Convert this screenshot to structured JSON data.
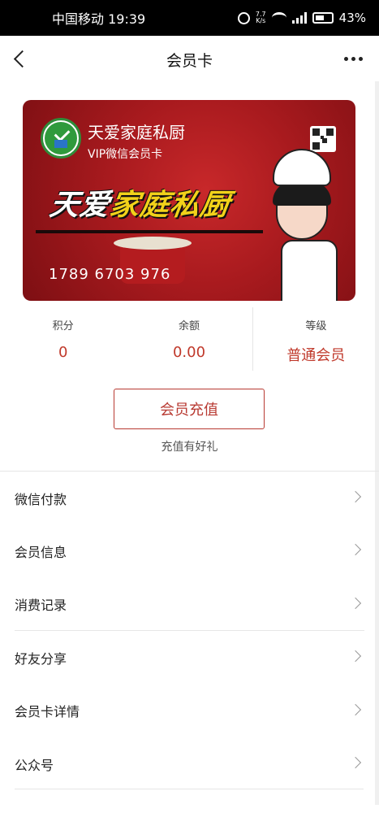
{
  "status_bar": {
    "carrier_time": "中国移动 19:39",
    "net_speed_top": "7.7",
    "net_speed_bottom": "K/s",
    "battery": "43%"
  },
  "nav": {
    "title": "会员卡"
  },
  "card": {
    "shop_name": "天爱家庭私厨",
    "card_type": "VIP微信会员卡",
    "banner_part1": "天爱",
    "banner_part2": "家庭私厨",
    "number": "1789 6703 976",
    "colors": {
      "card": "#a81a1e",
      "accent": "#f2d21a"
    }
  },
  "stats": [
    {
      "label": "积分",
      "value": "0"
    },
    {
      "label": "余额",
      "value": "0.00"
    },
    {
      "label": "等级",
      "value": "普通会员"
    }
  ],
  "recharge": {
    "button_label": "会员充值",
    "tip": "充值有好礼"
  },
  "menu": [
    {
      "label": "微信付款"
    },
    {
      "label": "会员信息"
    },
    {
      "label": "消费记录"
    },
    {
      "label": "好友分享"
    },
    {
      "label": "会员卡详情"
    },
    {
      "label": "公众号"
    }
  ],
  "theme": {
    "accent": "#c0392b"
  }
}
